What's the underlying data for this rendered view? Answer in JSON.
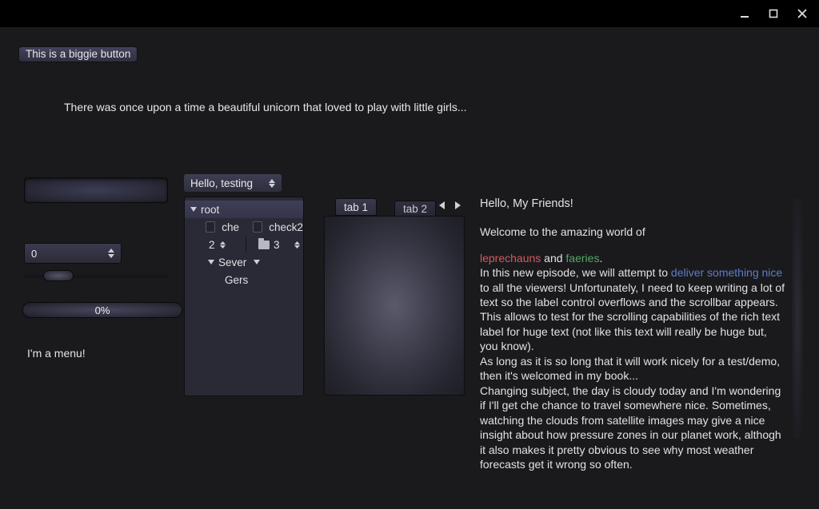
{
  "window": {
    "minimize": "–",
    "maximize": "◻",
    "close": "✕"
  },
  "biggie_button": "This is a biggie button",
  "story_text": "There was once upon a time a beautiful unicorn that loved to play with little girls...",
  "spinbox_value": "0",
  "progress_text": "0%",
  "menu_label": "I'm a menu!",
  "dropdown_label": "Hello, testing",
  "tree": {
    "root": "root",
    "che": "che",
    "check2": "check2",
    "num2": "2",
    "num3": "3",
    "sever": "Sever",
    "gers": "Gers"
  },
  "tabs": {
    "t1": "tab 1",
    "t2": "tab 2"
  },
  "rich": {
    "title": "Hello, My Friends!",
    "p1a": "Welcome to the amazing world of ",
    "lep": "leprechauns",
    "and": " and ",
    "fae": "faeries",
    "dot": ".",
    "p2a": "In this new episode, we will attempt to ",
    "link": "deliver something nice",
    "p2b": " to all the viewers! Unfortunately, I need to keep writing a lot of text so the label control overflows and the scrollbar appears.",
    "p3": "This allows to test for the scrolling capabilities of the rich text label for huge text (not like this text will really be huge but, you know).",
    "p4": "As long as it is so long that it will work nicely for a test/demo, then it's welcomed in my book...",
    "p5": "Changing subject, the day is cloudy today and I'm wondering if I'll get che chance to travel somewhere nice. Sometimes, watching the clouds from satellite images may give a nice insight about how pressure zones in our planet work, althogh it also makes it pretty obvious to see why most weather forecasts get it wrong so often."
  }
}
